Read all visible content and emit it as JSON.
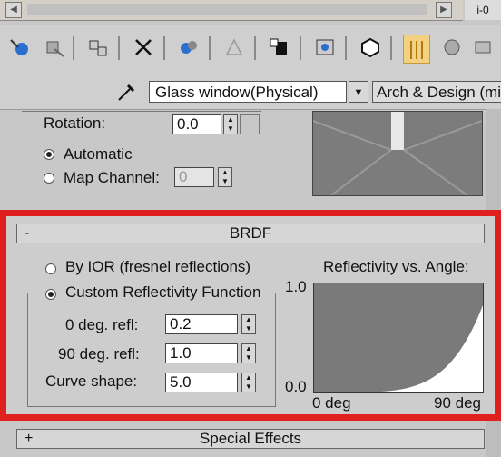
{
  "top_bar": {
    "scroll_left_arrow": "◀",
    "scroll_right_arrow": "▶",
    "corner_text": "i-0"
  },
  "toolbar": {
    "icons": [
      "get-material-icon",
      "put-to-scene-icon",
      "assign-material-icon",
      "delete-icon",
      "make-unique-icon",
      "put-to-library-icon",
      "material-id-channel-icon",
      "show-map-icon",
      "show-end-result-icon",
      "go-to-parent-icon",
      "go-forward-icon"
    ]
  },
  "material": {
    "name": "Glass window(Physical)",
    "dropdown_arrow": "▼",
    "type": "Arch & Design (mi)"
  },
  "upper": {
    "rotation_label": "Rotation:",
    "rotation_value": "0.0",
    "automatic_label": "Automatic",
    "map_channel_label": "Map Channel:",
    "map_channel_value": "0"
  },
  "brdf": {
    "collapse_sign": "-",
    "title": "BRDF",
    "by_ior_label": "By IOR (fresnel reflections)",
    "custom_label": "Custom Reflectivity Function",
    "deg0_label": "0 deg. refl:",
    "deg0_value": "0.2",
    "deg90_label": "90 deg. refl:",
    "deg90_value": "1.0",
    "curve_label": "Curve shape:",
    "curve_value": "5.0",
    "selected": "custom"
  },
  "chart_data": {
    "type": "area",
    "title": "Reflectivity vs. Angle:",
    "ylim": [
      0.0,
      1.0
    ],
    "y_ticks": [
      "1.0",
      "0.0"
    ],
    "x_ticks": [
      "0 deg",
      "90 deg"
    ],
    "curve": {
      "min": 0.2,
      "max": 1.0,
      "shape": 5.0
    }
  },
  "special_effects": {
    "expand_sign": "+",
    "title": "Special Effects"
  }
}
